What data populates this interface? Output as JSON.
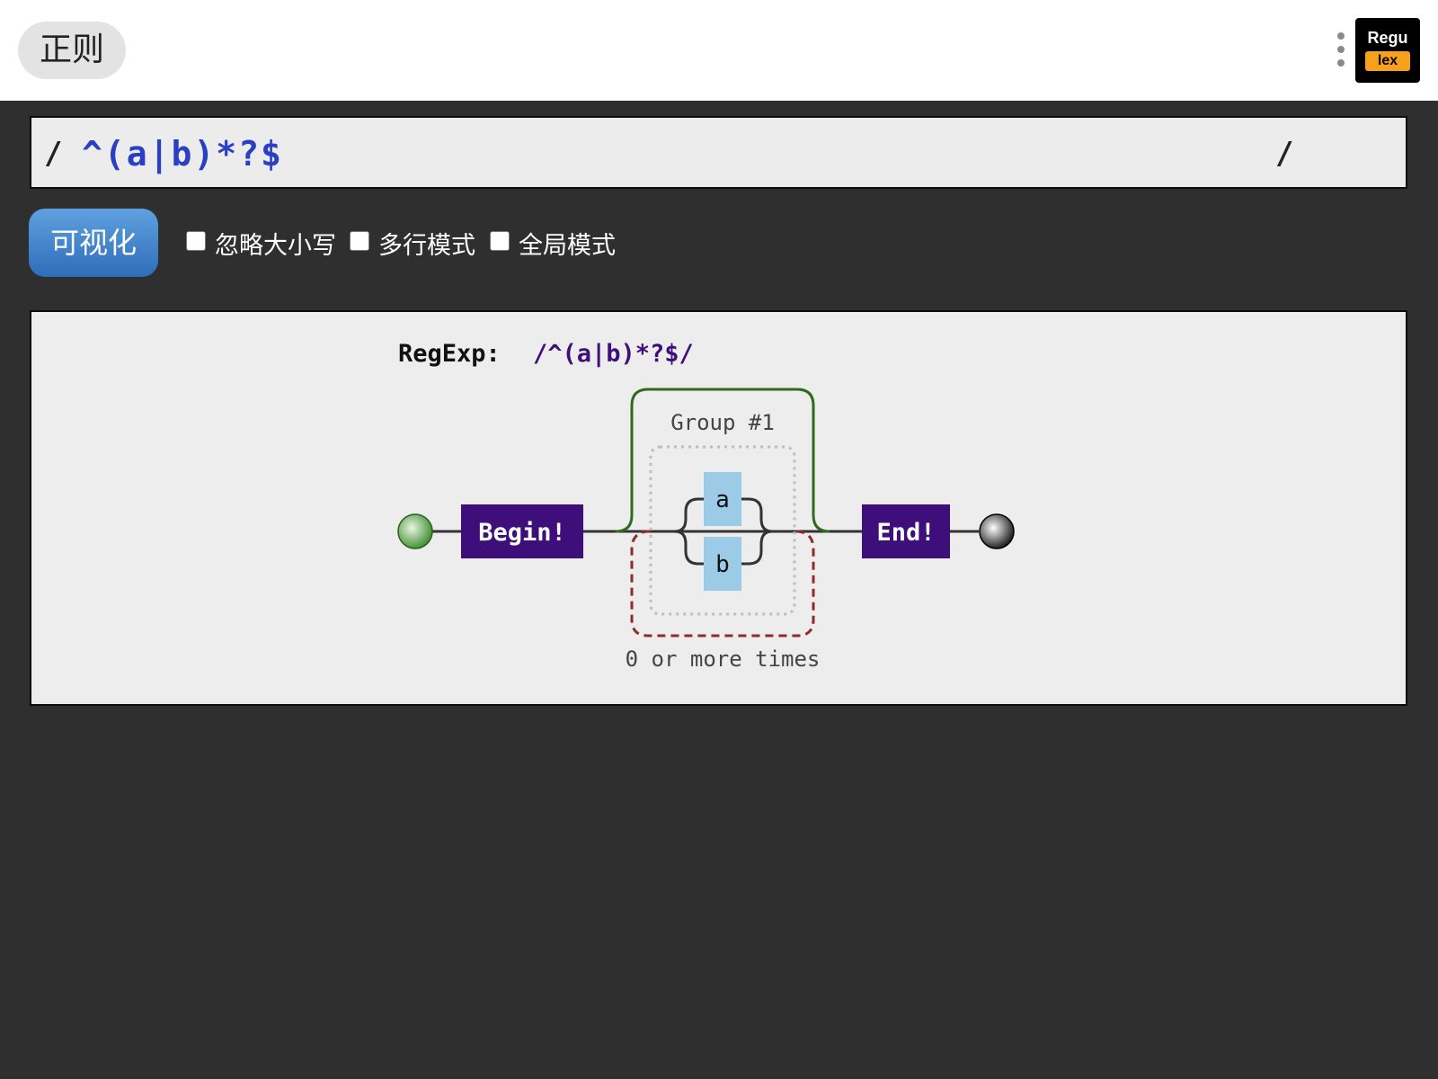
{
  "header": {
    "title": "正则",
    "logo_top": "Regu",
    "logo_bottom": "lex"
  },
  "input": {
    "left_delim": "/",
    "pattern": "^(a|b)*?$",
    "right_delim": "/"
  },
  "toolbar": {
    "visualize_label": "可视化",
    "options": [
      {
        "label": "忽略大小写",
        "checked": false
      },
      {
        "label": "多行模式",
        "checked": false
      },
      {
        "label": "全局模式",
        "checked": false
      }
    ]
  },
  "diagram": {
    "caption_prefix": "RegExp:",
    "caption_regex": "/^(a|b)*?$/",
    "begin_label": "Begin!",
    "end_label": "End!",
    "group_label": "Group #1",
    "branch_a": "a",
    "branch_b": "b",
    "repeat_label": "0 or more times"
  },
  "colors": {
    "accent_blue": "#2a3fc4",
    "node_purple": "#3e0f7a",
    "literal_blue": "#9ccbe8",
    "group_green": "#2f6a1d",
    "repeat_red": "#8e2b2b"
  }
}
